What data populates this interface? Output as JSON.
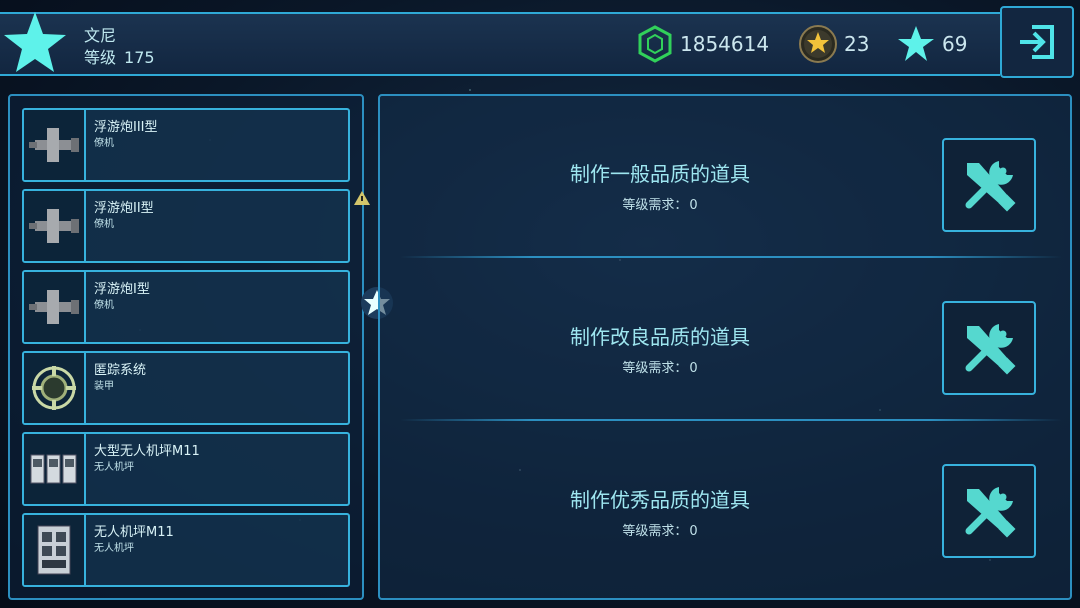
{
  "player": {
    "name": "文尼",
    "level_label": "等级",
    "level": "175"
  },
  "currencies": {
    "credits": "1854614",
    "gold": "23",
    "stars": "69"
  },
  "colors": {
    "accent": "#37b2dd",
    "star": "#5ef2ea",
    "text": "#9ee6f0"
  },
  "items": [
    {
      "name": "浮游炮III型",
      "type": "僚机",
      "icon": "drone-cannon-icon"
    },
    {
      "name": "浮游炮II型",
      "type": "僚机",
      "icon": "drone-cannon-icon"
    },
    {
      "name": "浮游炮I型",
      "type": "僚机",
      "icon": "drone-cannon-icon"
    },
    {
      "name": "匿踪系统",
      "type": "装甲",
      "icon": "stealth-system-icon"
    },
    {
      "name": "大型无人机坪M11",
      "type": "无人机坪",
      "icon": "drone-pad-large-icon"
    },
    {
      "name": "无人机坪M11",
      "type": "无人机坪",
      "icon": "drone-pad-icon"
    }
  ],
  "crafting": {
    "req_label": "等级需求：",
    "options": [
      {
        "title": "制作一般品质的道具",
        "req_level": "0"
      },
      {
        "title": "制作改良品质的道具",
        "req_level": "0"
      },
      {
        "title": "制作优秀品质的道具",
        "req_level": "0"
      }
    ]
  }
}
